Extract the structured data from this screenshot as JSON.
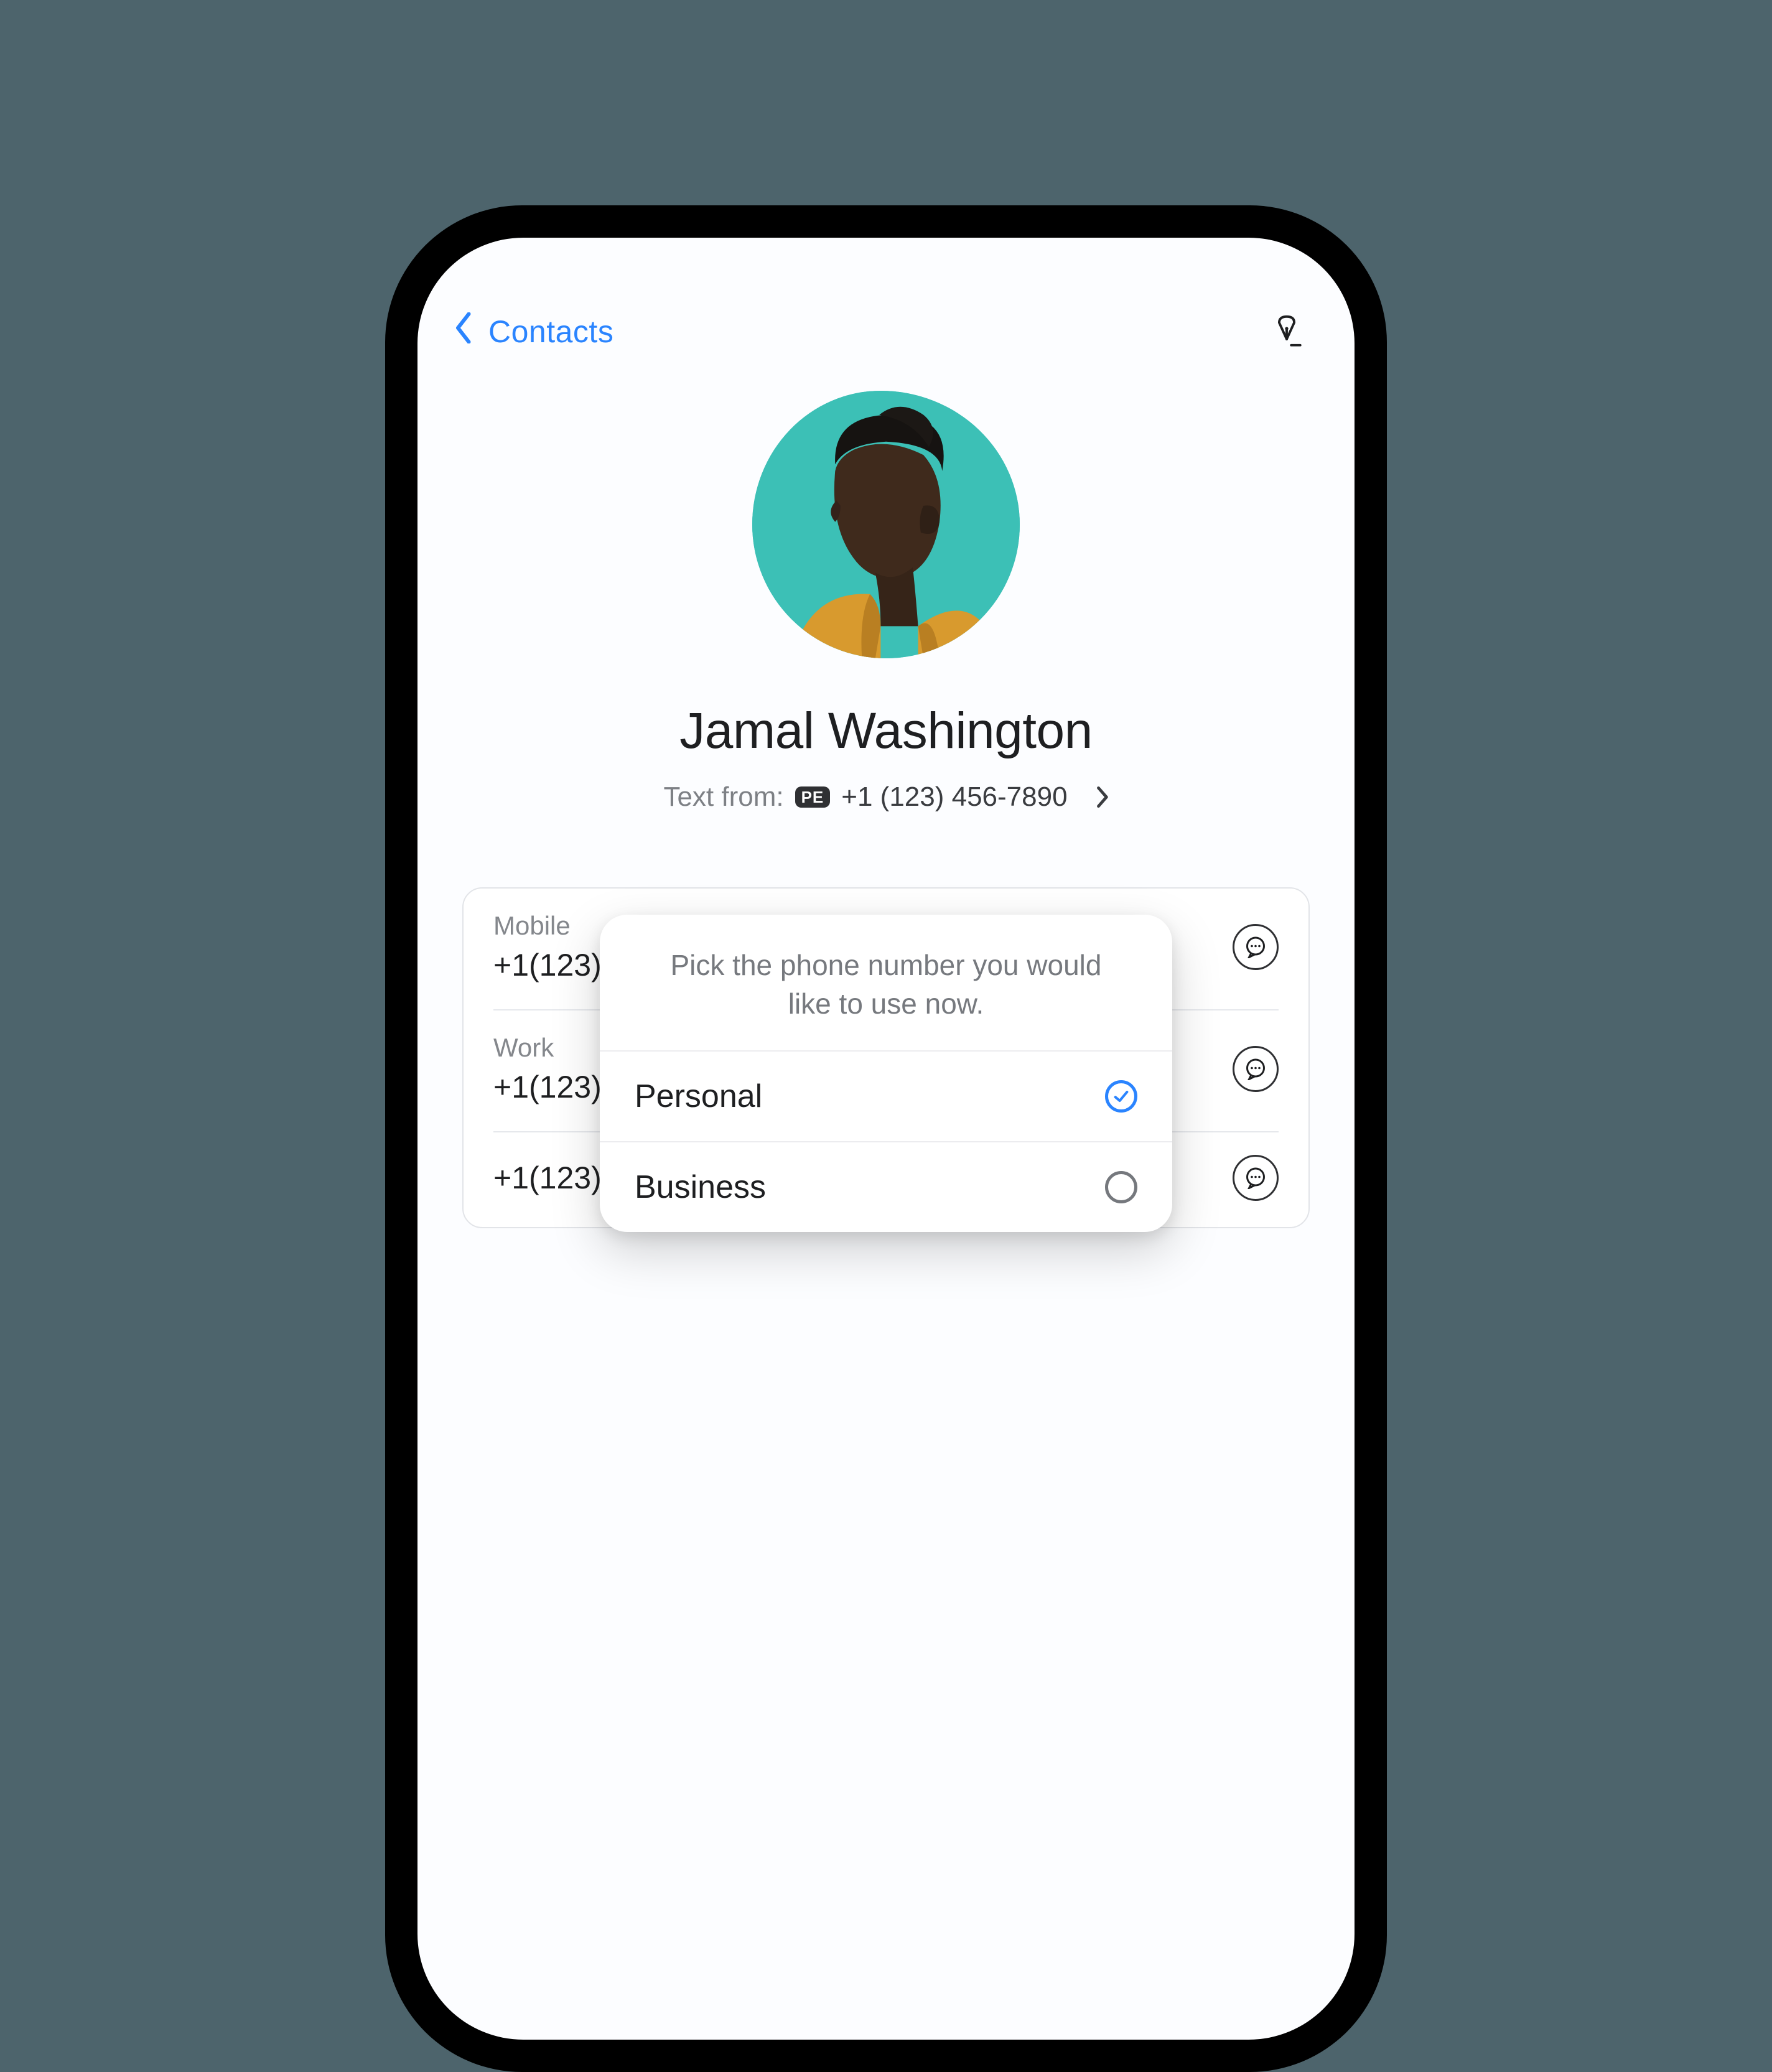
{
  "header": {
    "back_label": "Contacts"
  },
  "contact": {
    "name": "Jamal Washington",
    "text_from_label": "Text from:",
    "text_from_badge": "PE",
    "text_from_number": "+1 (123) 456-7890"
  },
  "numbers": [
    {
      "type": "Mobile",
      "value": "+1(123)456-7890"
    },
    {
      "type": "Work",
      "value": "+1(123)456-7890"
    },
    {
      "type": "",
      "value": "+1(123)456-7890"
    }
  ],
  "popover": {
    "hint": "Pick the phone number you would like to use now.",
    "options": [
      {
        "label": "Personal",
        "selected": true
      },
      {
        "label": "Business",
        "selected": false
      }
    ]
  }
}
